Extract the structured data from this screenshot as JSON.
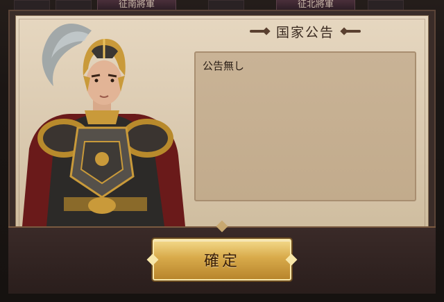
{
  "background": {
    "tabs": [
      "征南將軍",
      "征北將軍"
    ]
  },
  "dialog": {
    "title": "国家公告",
    "content": "公告無し",
    "confirm_label": "確定"
  },
  "colors": {
    "parchment": "#e6d7c0",
    "content_box": "#c9b396",
    "button_gold": "#d8aa4a",
    "frame_dark": "#3a2c28"
  },
  "icons": [
    "general-portrait",
    "title-decoration"
  ]
}
